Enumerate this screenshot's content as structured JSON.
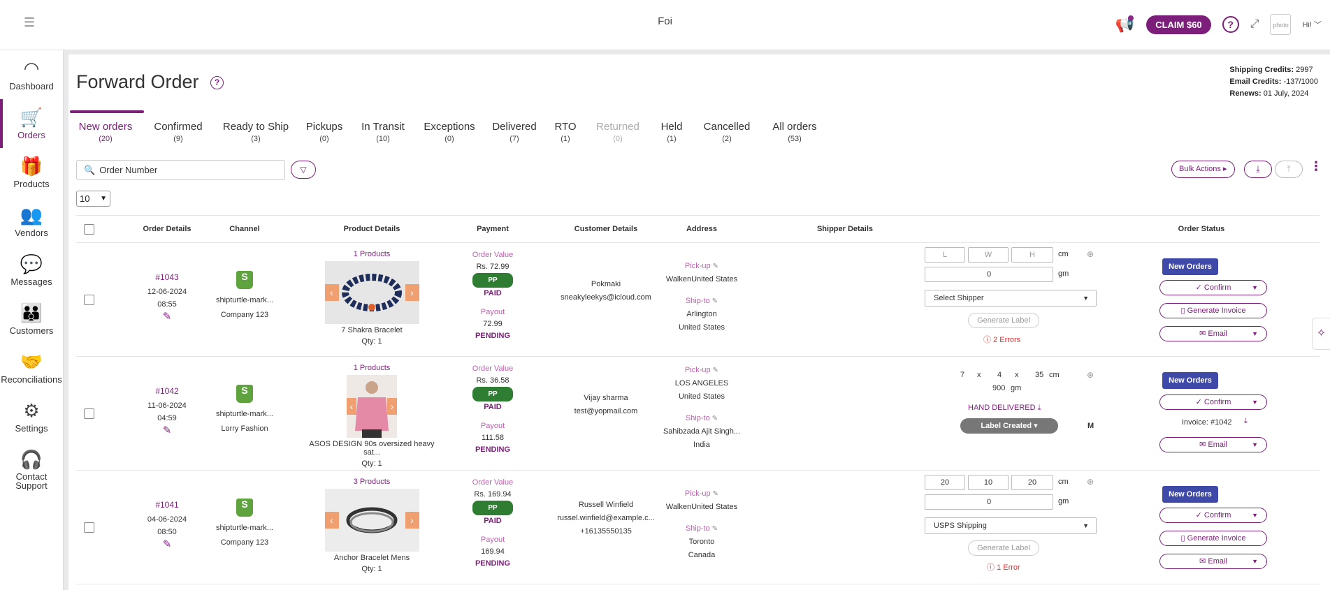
{
  "app": {
    "title": "Foi"
  },
  "topbar": {
    "claim_label": "CLAIM $60",
    "greeting": "Hi!",
    "avatar_text": "photo"
  },
  "sidebar": {
    "items": [
      {
        "label": "Dashboard",
        "icon": "gauge-icon"
      },
      {
        "label": "Orders",
        "icon": "cart-icon"
      },
      {
        "label": "Products",
        "icon": "gift-icon"
      },
      {
        "label": "Vendors",
        "icon": "users-icon"
      },
      {
        "label": "Messages",
        "icon": "chat-icon"
      },
      {
        "label": "Customers",
        "icon": "customers-icon"
      },
      {
        "label": "Reconciliations",
        "icon": "handshake-icon"
      },
      {
        "label": "Settings",
        "icon": "gear-icon"
      },
      {
        "label": "Contact Support",
        "icon": "headset-icon"
      }
    ]
  },
  "page": {
    "title": "Forward Order"
  },
  "credits": {
    "shipping_label": "Shipping Credits:",
    "shipping_value": "2997",
    "email_label": "Email Credits:",
    "email_value": "-137/1000",
    "renews_label": "Renews:",
    "renews_value": "01 July, 2024"
  },
  "tabs": [
    {
      "label": "New orders",
      "count": "(20)"
    },
    {
      "label": "Confirmed",
      "count": "(9)"
    },
    {
      "label": "Ready to Ship",
      "count": "(3)"
    },
    {
      "label": "Pickups",
      "count": "(0)"
    },
    {
      "label": "In Transit",
      "count": "(10)"
    },
    {
      "label": "Exceptions",
      "count": "(0)"
    },
    {
      "label": "Delivered",
      "count": "(7)"
    },
    {
      "label": "RTO",
      "count": "(1)"
    },
    {
      "label": "Returned",
      "count": "(0)"
    },
    {
      "label": "Held",
      "count": "(1)"
    },
    {
      "label": "Cancelled",
      "count": "(2)"
    },
    {
      "label": "All orders",
      "count": "(53)"
    }
  ],
  "search": {
    "placeholder": "Order Number"
  },
  "toolbar": {
    "bulk_label": "Bulk Actions",
    "page_size": "10"
  },
  "table": {
    "headers": [
      "Order Details",
      "Channel",
      "Product Details",
      "Payment",
      "Customer Details",
      "Address",
      "Shipper Details",
      "Order Status"
    ],
    "labels": {
      "order_value": "Order Value",
      "pp": "PP",
      "paid": "PAID",
      "payout": "Payout",
      "pending": "PENDING",
      "pickup": "Pick-up",
      "shipto": "Ship-to",
      "cm": "cm",
      "gm": "gm",
      "x": "x",
      "generate_label": "Generate Label",
      "new_orders": "New Orders",
      "confirm": "Confirm",
      "generate_invoice": "Generate Invoice",
      "email": "Email",
      "select_shipper": "Select Shipper",
      "hand_delivered": "HAND DELIVERED",
      "label_created": "Label Created",
      "m": "M"
    },
    "rows": [
      {
        "order": "#1043",
        "date": "12-06-2024",
        "time": "08:55",
        "channel": "shipturtle-mark...",
        "company": "Company 123",
        "products": "1 Products",
        "product_name": "7 Shakra Bracelet",
        "qty": "Qty: 1",
        "order_value": "Rs. 72.99",
        "payout": "72.99",
        "customer_name": "Pokmaki",
        "customer_email": "sneakyleekys@icloud.com",
        "customer_phone": "",
        "pickup": "WalkenUnited States",
        "shipto_1": "Arlington",
        "shipto_2": "United States",
        "L": "L",
        "W": "W",
        "H": "H",
        "weight": "0",
        "shipper": "Select Shipper",
        "errors": "2 Errors"
      },
      {
        "order": "#1042",
        "date": "11-06-2024",
        "time": "04:59",
        "channel": "shipturtle-mark...",
        "company": "Lorry Fashion",
        "products": "1 Products",
        "product_name": "ASOS DESIGN 90s oversized heavy sat...",
        "qty": "Qty: 1",
        "order_value": "Rs. 36.58",
        "payout": "111.58",
        "customer_name": "Vijay sharma",
        "customer_email": "test@yopmail.com",
        "pickup_1": "LOS ANGELES",
        "pickup_2": "United States",
        "shipto_1": "Sahibzada Ajit Singh...",
        "shipto_2": "India",
        "L": "7",
        "W": "4",
        "H": "35",
        "weight": "900",
        "invoice": "Invoice: #1042"
      },
      {
        "order": "#1041",
        "date": "04-06-2024",
        "time": "08:50",
        "channel": "shipturtle-mark...",
        "company": "Company 123",
        "products": "3 Products",
        "product_name": "Anchor Bracelet Mens",
        "qty": "Qty: 1",
        "order_value": "Rs. 169.94",
        "payout": "169.94",
        "customer_name": "Russell Winfield",
        "customer_email": "russel.winfield@example.c...",
        "customer_phone": "+16135550135",
        "pickup": "WalkenUnited States",
        "shipto_1": "Toronto",
        "shipto_2": "Canada",
        "L": "20",
        "W": "10",
        "H": "20",
        "weight": "0",
        "shipper": "USPS Shipping",
        "errors": "1 Error"
      }
    ]
  },
  "colors": {
    "brand": "#7c1f7a",
    "new_orders": "#3f4aa8",
    "paid_badge": "#2e7d32"
  }
}
